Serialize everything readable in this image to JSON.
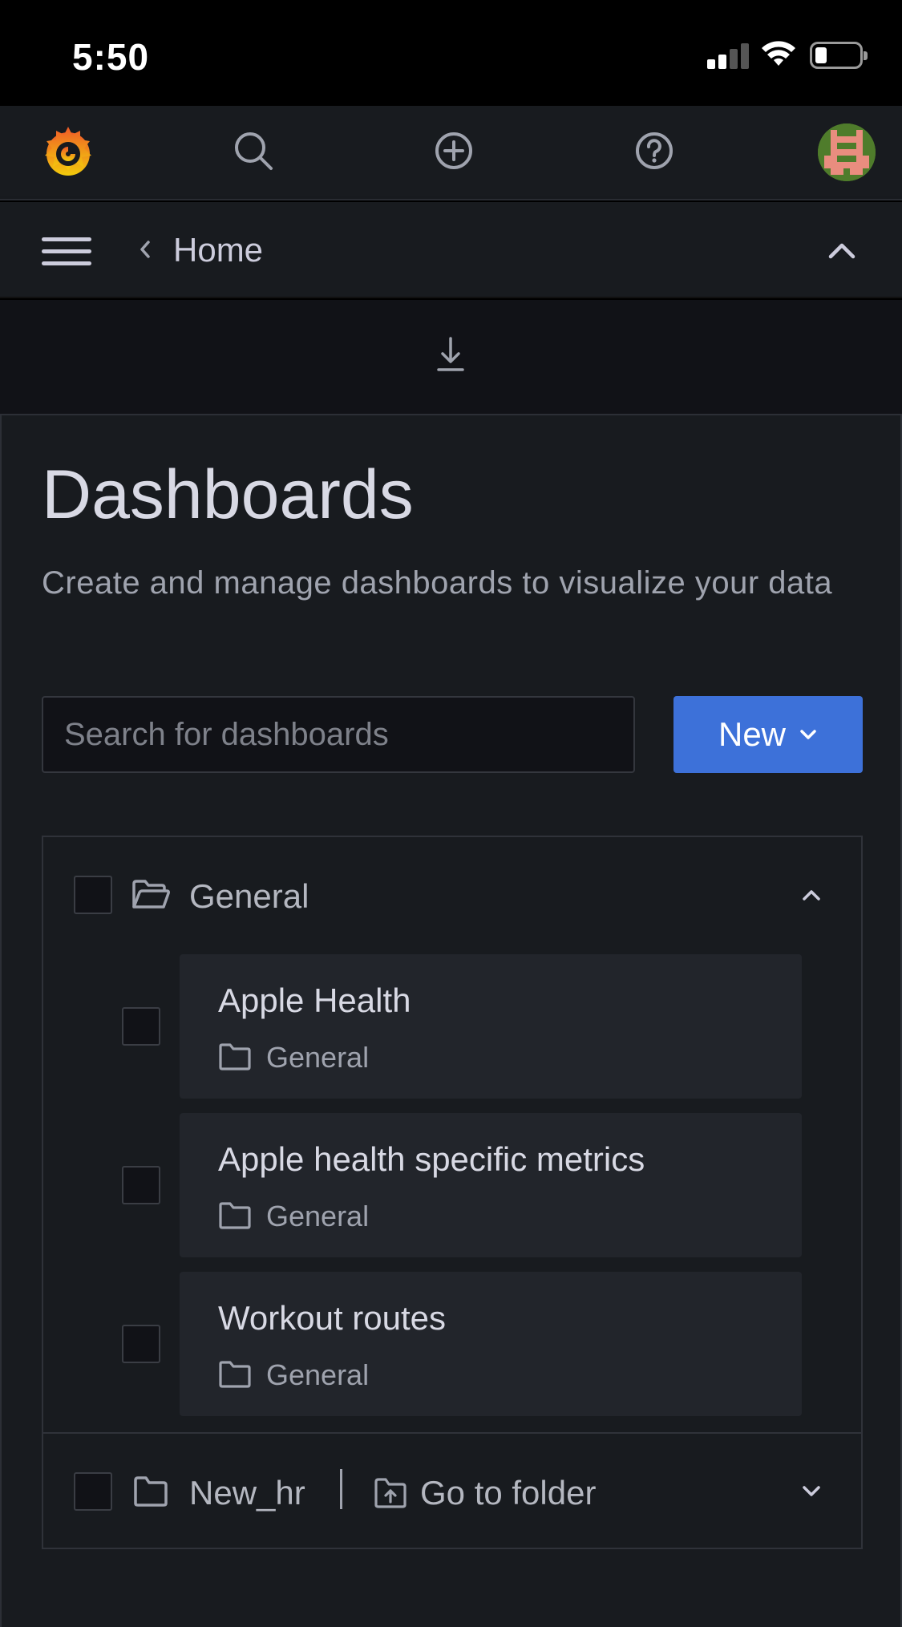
{
  "status_bar": {
    "time": "5:50"
  },
  "breadcrumb": {
    "home": "Home"
  },
  "page": {
    "title": "Dashboards",
    "subtitle": "Create and manage dashboards to visualize your data"
  },
  "search": {
    "placeholder": "Search for dashboards",
    "value": ""
  },
  "new_button": {
    "label": "New"
  },
  "folders": [
    {
      "name": "General",
      "expanded": true,
      "dashboards": [
        {
          "title": "Apple Health",
          "folder": "General"
        },
        {
          "title": "Apple health specific metrics",
          "folder": "General"
        },
        {
          "title": "Workout routes",
          "folder": "General"
        }
      ]
    },
    {
      "name": "New_hr",
      "expanded": false,
      "go_to_folder_label": "Go to folder"
    }
  ],
  "colors": {
    "accent": "#3d71d9",
    "panel_bg": "#181b1f",
    "card_bg": "#22252b",
    "text": "#ccccdc"
  },
  "icons": [
    "grafana-logo-icon",
    "search-icon",
    "plus-circle-icon",
    "help-icon",
    "avatar",
    "menu-icon",
    "chevron-left-icon",
    "chevron-up-icon",
    "download-icon",
    "folder-open-icon",
    "folder-icon",
    "folder-upload-icon",
    "chevron-down-icon"
  ]
}
